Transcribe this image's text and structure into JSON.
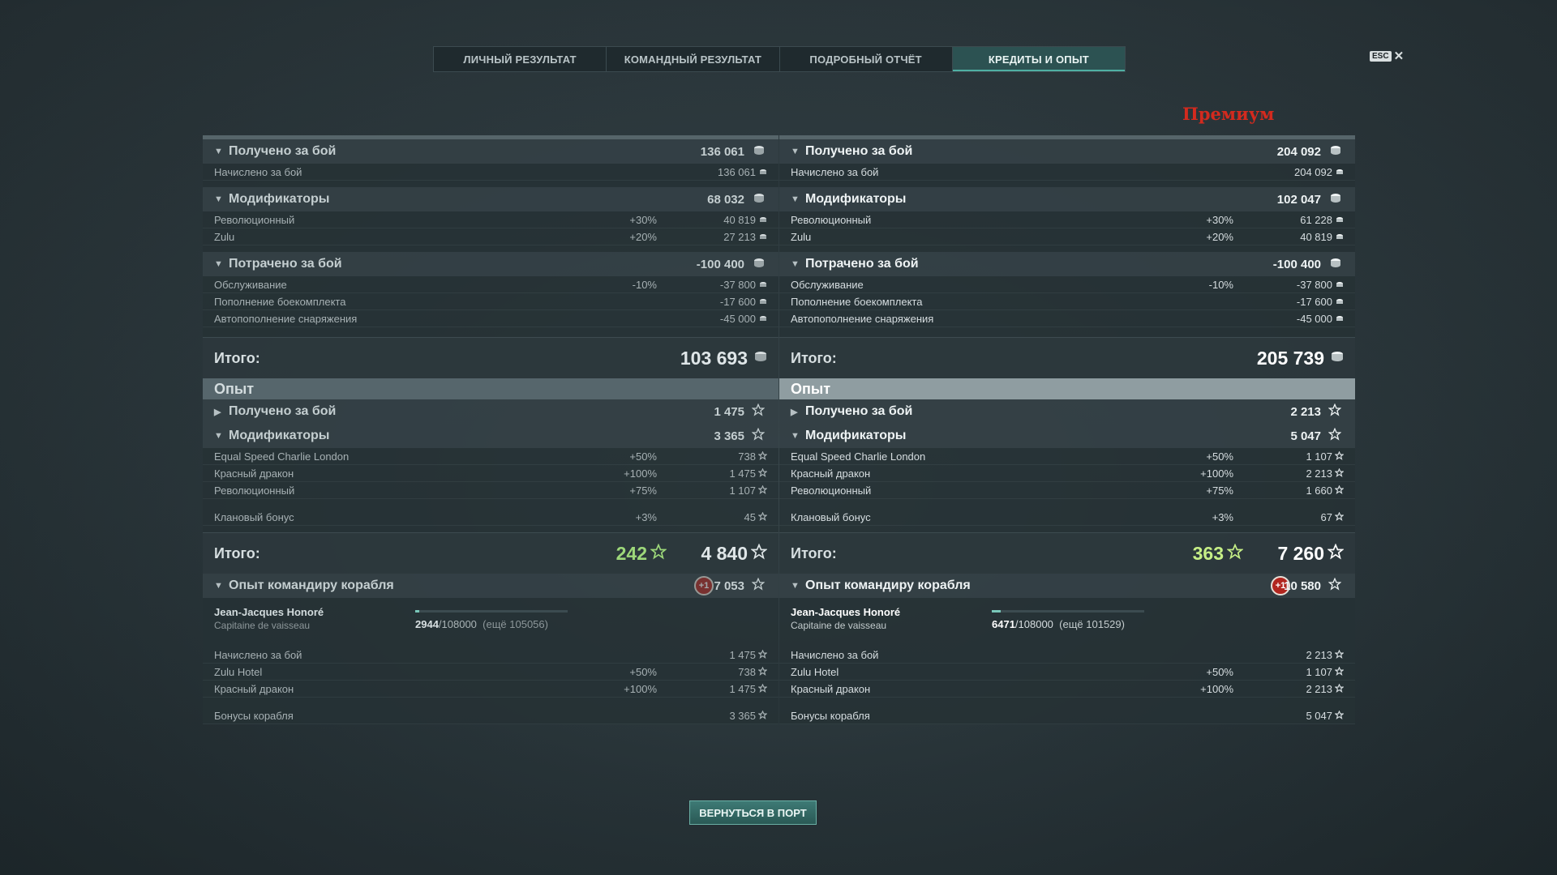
{
  "tabs": [
    {
      "label": "ЛИЧНЫЙ РЕЗУЛЬТАТ",
      "active": false
    },
    {
      "label": "КОМАНДНЫЙ РЕЗУЛЬТАТ",
      "active": false
    },
    {
      "label": "ПОДРОБНЫЙ ОТЧЁТ",
      "active": false
    },
    {
      "label": "КРЕДИТЫ И ОПЫТ",
      "active": true
    }
  ],
  "esc_label": "ESC",
  "premium_label": "Премиум",
  "columns": {
    "standard": {
      "credits": {
        "earned": {
          "label": "Получено за бой",
          "value": "136 061"
        },
        "earned_rows": [
          {
            "label": "Начислено за бой",
            "value": "136 061"
          }
        ],
        "modifiers": {
          "label": "Модификаторы",
          "value": "68 032"
        },
        "modifier_rows": [
          {
            "label": "Революционный",
            "pct": "+30%",
            "value": "40 819"
          },
          {
            "label": "Zulu",
            "pct": "+20%",
            "value": "27 213"
          }
        ],
        "spent": {
          "label": "Потрачено за бой",
          "value": "-100 400"
        },
        "spent_rows": [
          {
            "label": "Обслуживание",
            "pct": "-10%",
            "value": "-37 800"
          },
          {
            "label": "Пополнение боекомплекта",
            "pct": "",
            "value": "-17 600"
          },
          {
            "label": "Автопополнение снаряжения",
            "pct": "",
            "value": "-45 000"
          }
        ],
        "total_label": "Итого:",
        "total_value": "103 693"
      },
      "xp": {
        "header": "Опыт",
        "earned": {
          "label": "Получено за бой",
          "value": "1 475"
        },
        "modifiers": {
          "label": "Модификаторы",
          "value": "3 365"
        },
        "modifier_rows": [
          {
            "label": "Equal Speed Charlie London",
            "pct": "+50%",
            "value": "738"
          },
          {
            "label": "Красный дракон",
            "pct": "+100%",
            "value": "1 475"
          },
          {
            "label": "Революционный",
            "pct": "+75%",
            "value": "1 107"
          }
        ],
        "clan": {
          "label": "Клановый бонус",
          "pct": "+3%",
          "value": "45"
        },
        "total_label": "Итого:",
        "free_xp": "242",
        "total_value": "4 840"
      },
      "commander": {
        "label": "Опыт командиру корабля",
        "badge": "+1",
        "value": "7 053",
        "name": "Jean-Jacques Honoré",
        "rank": "Capitaine de vaisseau",
        "progress": 0.027,
        "xp_current": "2944",
        "xp_max": "/108000",
        "xp_remaining": "(ещё 105056)",
        "rows": [
          {
            "label": "Начислено за бой",
            "pct": "",
            "value": "1 475"
          },
          {
            "label": "Zulu Hotel",
            "pct": "+50%",
            "value": "738"
          },
          {
            "label": "Красный дракон",
            "pct": "+100%",
            "value": "1 475"
          }
        ],
        "bonus": {
          "label": "Бонусы корабля",
          "value": "3 365"
        }
      }
    },
    "premium": {
      "credits": {
        "earned": {
          "label": "Получено за бой",
          "value": "204 092"
        },
        "earned_rows": [
          {
            "label": "Начислено за бой",
            "value": "204 092"
          }
        ],
        "modifiers": {
          "label": "Модификаторы",
          "value": "102 047"
        },
        "modifier_rows": [
          {
            "label": "Революционный",
            "pct": "+30%",
            "value": "61 228"
          },
          {
            "label": "Zulu",
            "pct": "+20%",
            "value": "40 819"
          }
        ],
        "spent": {
          "label": "Потрачено за бой",
          "value": "-100 400"
        },
        "spent_rows": [
          {
            "label": "Обслуживание",
            "pct": "-10%",
            "value": "-37 800"
          },
          {
            "label": "Пополнение боекомплекта",
            "pct": "",
            "value": "-17 600"
          },
          {
            "label": "Автопополнение снаряжения",
            "pct": "",
            "value": "-45 000"
          }
        ],
        "total_label": "Итого:",
        "total_value": "205 739"
      },
      "xp": {
        "header": "Опыт",
        "earned": {
          "label": "Получено за бой",
          "value": "2 213"
        },
        "modifiers": {
          "label": "Модификаторы",
          "value": "5 047"
        },
        "modifier_rows": [
          {
            "label": "Equal Speed Charlie London",
            "pct": "+50%",
            "value": "1 107"
          },
          {
            "label": "Красный дракон",
            "pct": "+100%",
            "value": "2 213"
          },
          {
            "label": "Революционный",
            "pct": "+75%",
            "value": "1 660"
          }
        ],
        "clan": {
          "label": "Клановый бонус",
          "pct": "+3%",
          "value": "67"
        },
        "total_label": "Итого:",
        "free_xp": "363",
        "total_value": "7 260"
      },
      "commander": {
        "label": "Опыт командиру корабля",
        "badge": "+1",
        "value": "10 580",
        "name": "Jean-Jacques Honoré",
        "rank": "Capitaine de vaisseau",
        "progress": 0.06,
        "xp_current": "6471",
        "xp_max": "/108000",
        "xp_remaining": "(ещё 101529)",
        "rows": [
          {
            "label": "Начислено за бой",
            "pct": "",
            "value": "2 213"
          },
          {
            "label": "Zulu Hotel",
            "pct": "+50%",
            "value": "1 107"
          },
          {
            "label": "Красный дракон",
            "pct": "+100%",
            "value": "2 213"
          }
        ],
        "bonus": {
          "label": "Бонусы корабля",
          "value": "5 047"
        }
      }
    }
  },
  "icons": {
    "credits": "credits-coin-icon",
    "xp": "star-icon"
  },
  "colors": {
    "accent": "#2c5252",
    "free_xp": "#9dd87a",
    "premium": "#d32a1e",
    "badge": "#b1261f"
  },
  "back_button": "ВЕРНУТЬСЯ В ПОРТ"
}
